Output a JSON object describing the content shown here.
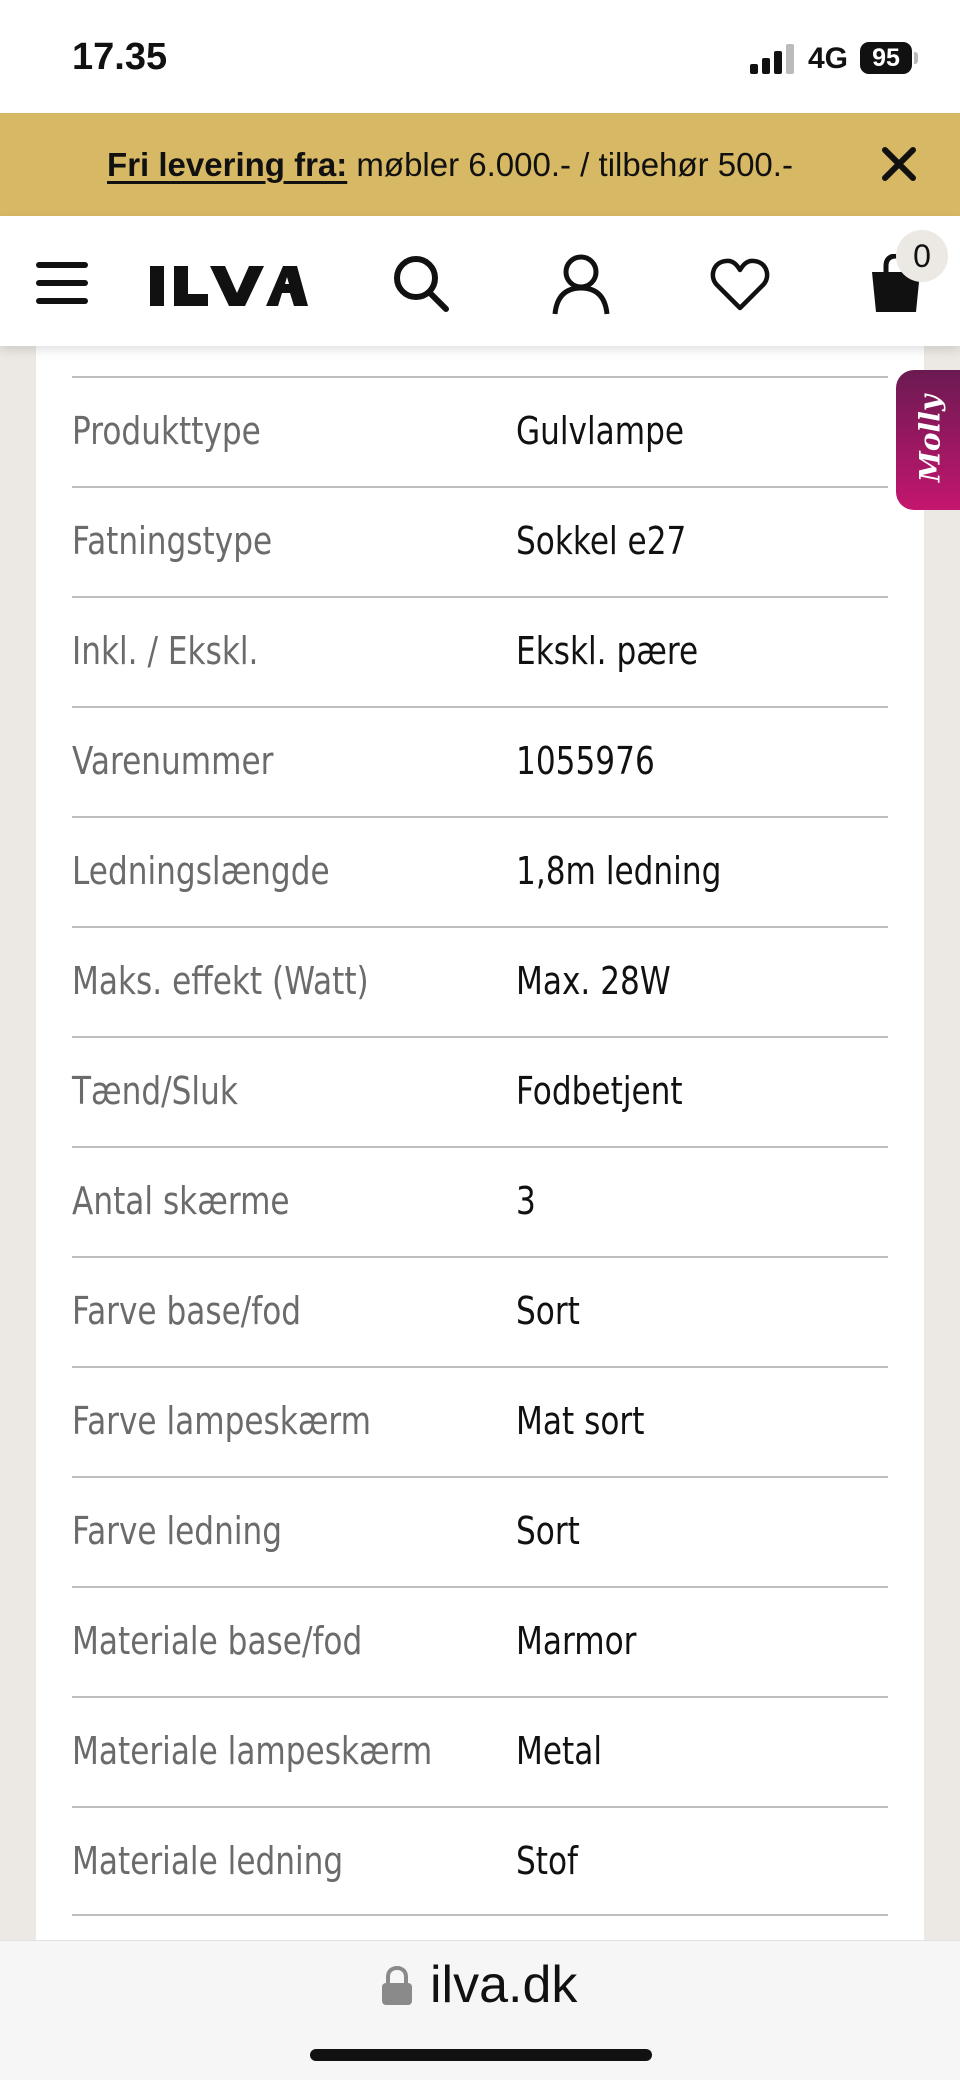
{
  "status_bar": {
    "time": "17.35",
    "network": "4G",
    "battery": "95",
    "icons": [
      "signal-icon",
      "battery-icon"
    ]
  },
  "promo_banner": {
    "strong_text": "Fri levering fra:",
    "text": " møbler 6.000.- / tilbehør 500.-",
    "close_icon": "close-icon",
    "background": "#d7b864"
  },
  "header": {
    "logo_text": "ILVA",
    "cart_count": "0",
    "icons": [
      "menu-icon",
      "search-icon",
      "account-icon",
      "heart-icon",
      "shopping-bag-icon"
    ]
  },
  "specs": [
    {
      "label": "Produkttype",
      "value": "Gulvlampe"
    },
    {
      "label": "Fatningstype",
      "value": "Sokkel e27"
    },
    {
      "label": "Inkl. / Ekskl.",
      "value": "Ekskl. pære"
    },
    {
      "label": "Varenummer",
      "value": "1055976"
    },
    {
      "label": "Ledningslængde",
      "value": "1,8m ledning"
    },
    {
      "label": "Maks. effekt (Watt)",
      "value": "Max. 28W"
    },
    {
      "label": "Tænd/Sluk",
      "value": "Fodbetjent"
    },
    {
      "label": "Antal skærme",
      "value": "3"
    },
    {
      "label": "Farve base/fod",
      "value": "Sort"
    },
    {
      "label": "Farve lampeskærm",
      "value": "Mat sort"
    },
    {
      "label": "Farve ledning",
      "value": "Sort"
    },
    {
      "label": "Materiale base/fod",
      "value": "Marmor"
    },
    {
      "label": "Materiale lampeskærm",
      "value": "Metal"
    },
    {
      "label": "Materiale ledning",
      "value": "Stof"
    }
  ],
  "chat_widget": {
    "label": "Molly",
    "colors": [
      "#6b1a52",
      "#c4166e"
    ]
  },
  "browser": {
    "url": "ilva.dk",
    "lock_icon": "lock-icon"
  }
}
